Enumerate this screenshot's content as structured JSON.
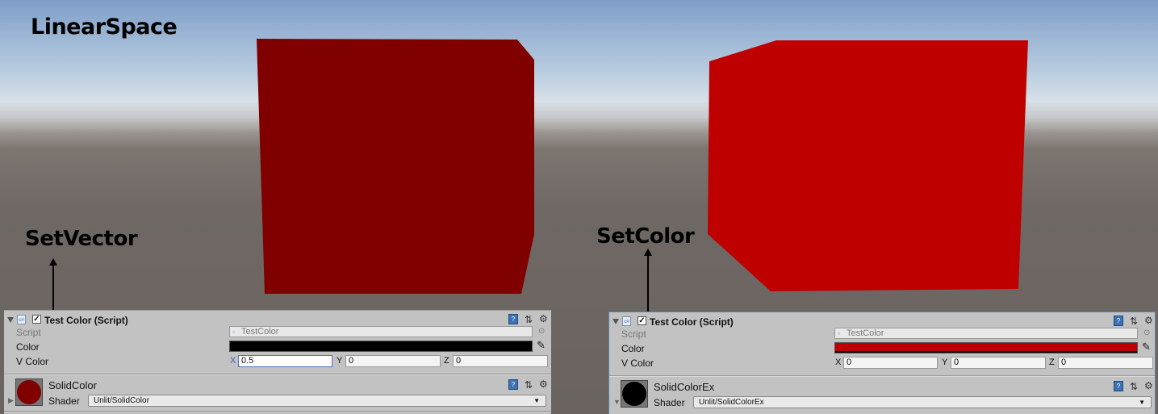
{
  "scene": {
    "title": "LinearSpace",
    "left_callout": "SetVector",
    "right_callout": "SetColor",
    "left_cube_color": "#800000",
    "right_cube_color": "#bf0000"
  },
  "left_panel": {
    "component_title": "Test Color (Script)",
    "script_label": "Script",
    "script_value": "TestColor",
    "color_label": "Color",
    "color_value": "#000000",
    "vcolor_label": "V Color",
    "vector": [
      {
        "axis": "X",
        "value": "0.5"
      },
      {
        "axis": "Y",
        "value": "0"
      },
      {
        "axis": "Z",
        "value": "0"
      }
    ],
    "material_name": "SolidColor",
    "material_swatch": "#800000",
    "shader_label": "Shader",
    "shader_value": "Unlit/SolidColor"
  },
  "right_panel": {
    "component_title": "Test Color (Script)",
    "script_label": "Script",
    "script_value": "TestColor",
    "color_label": "Color",
    "color_value": "#bf0000",
    "vcolor_label": "V Color",
    "vector": [
      {
        "axis": "X",
        "value": "0"
      },
      {
        "axis": "Y",
        "value": "0"
      },
      {
        "axis": "Z",
        "value": "0"
      }
    ],
    "material_name": "SolidColorEx",
    "material_swatch": "#000000",
    "shader_label": "Shader",
    "shader_value": "Unlit/SolidColorEx"
  },
  "icons": {
    "help": "help-book-icon",
    "preset": "preset-sliders-icon",
    "settings": "gear-icon",
    "eyedropper": "eyedropper-icon",
    "script_file": "cs-script-icon"
  }
}
